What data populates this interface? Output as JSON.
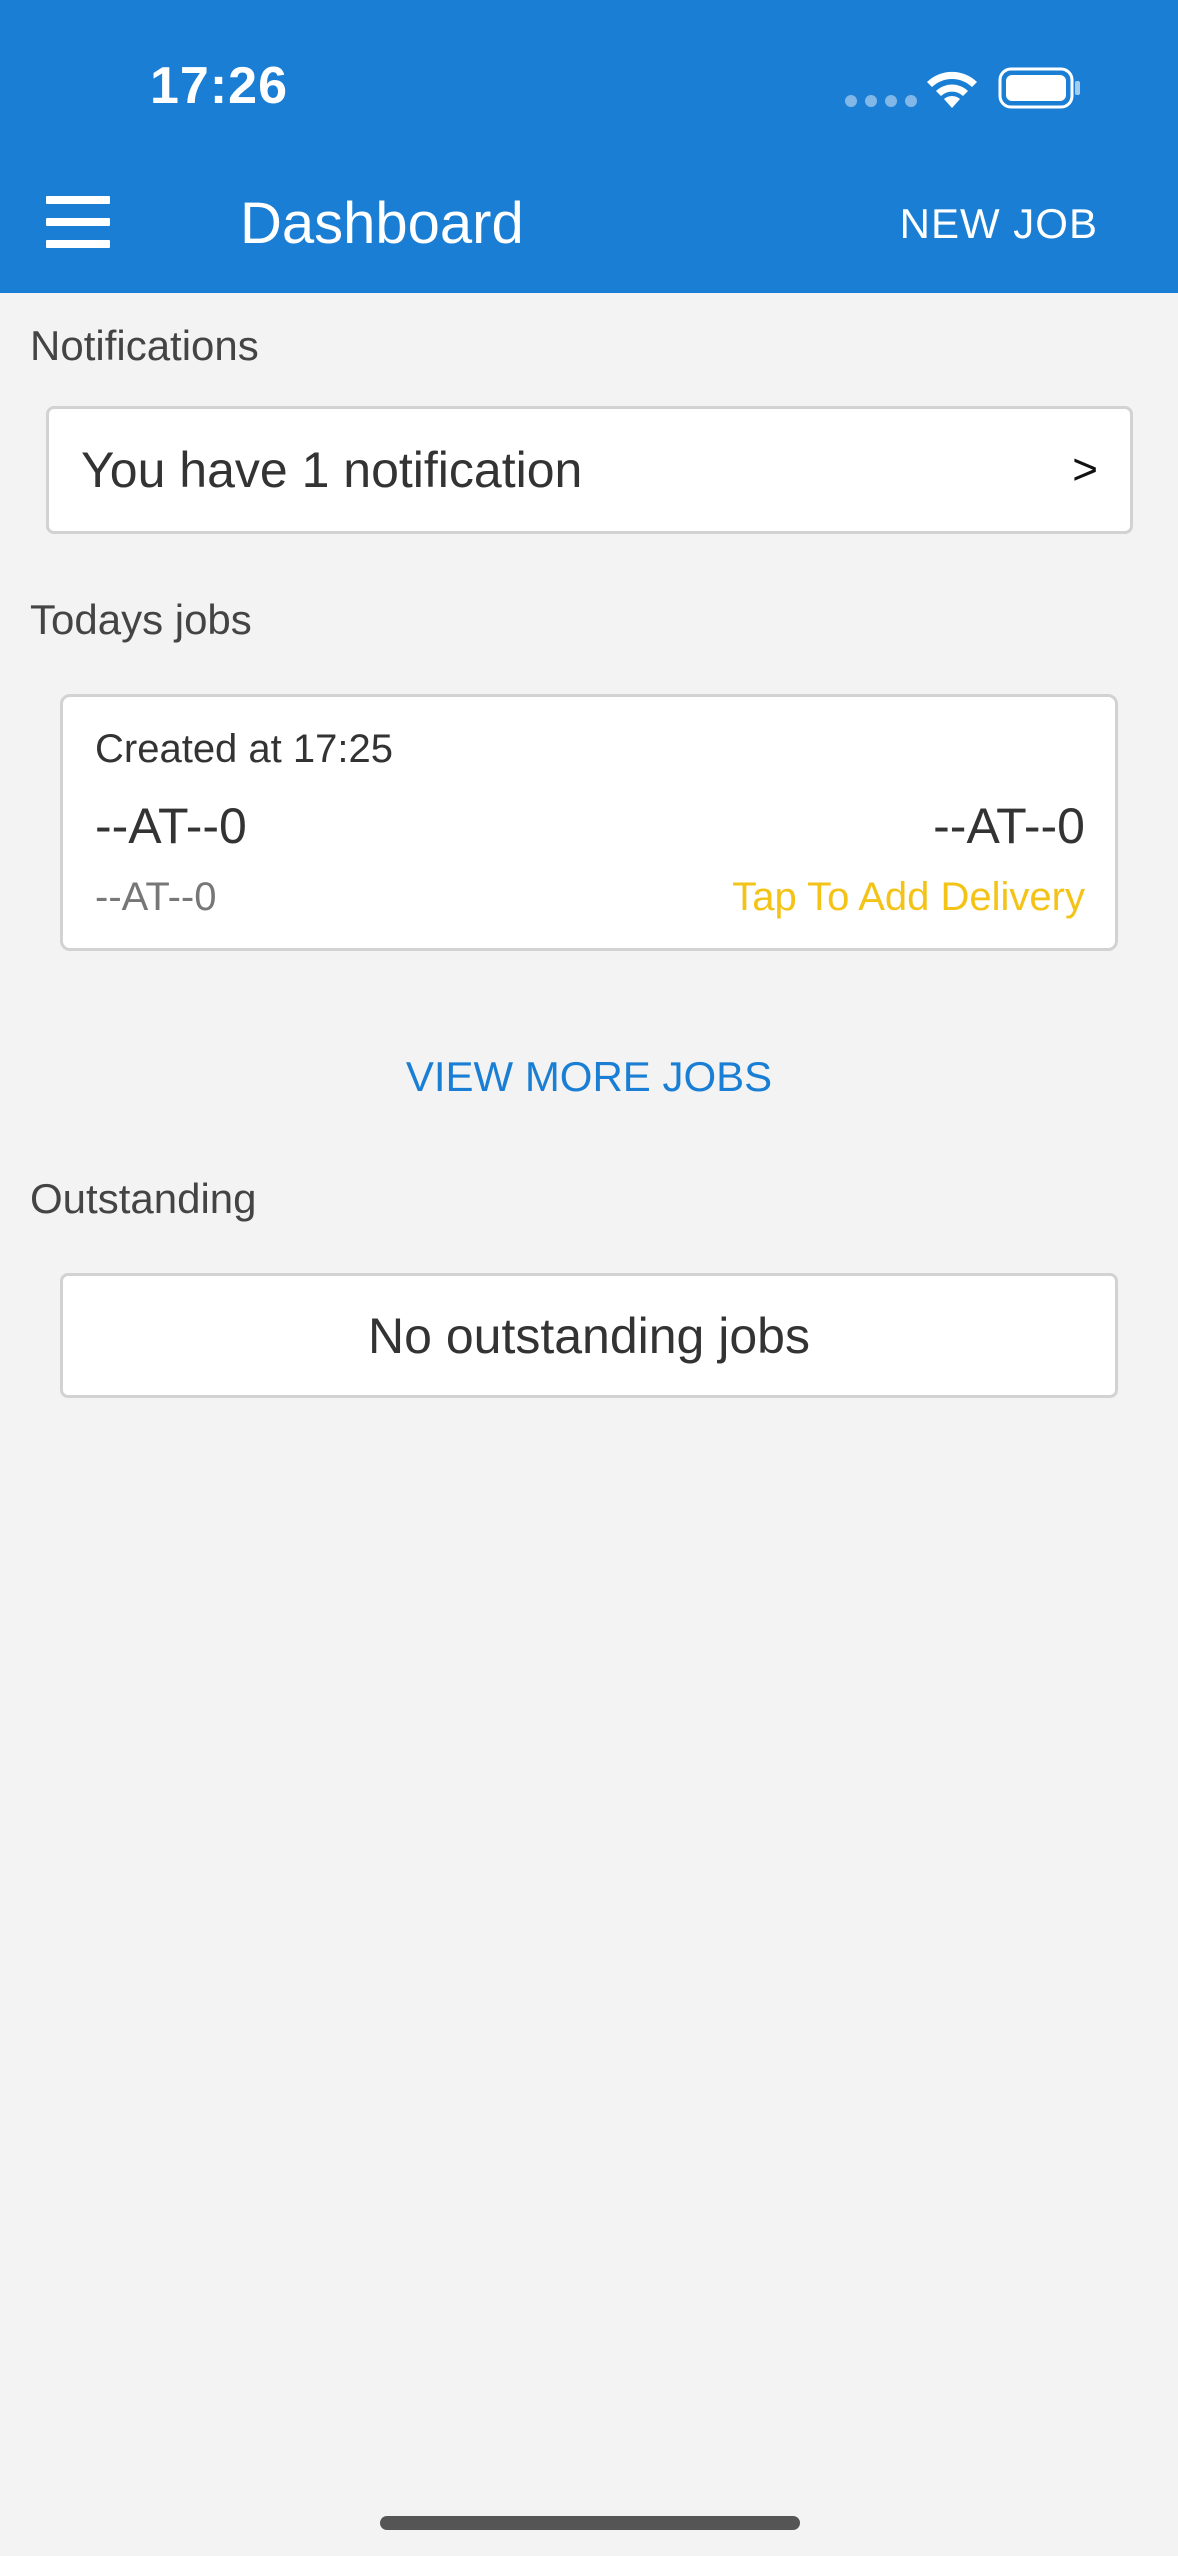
{
  "status_bar": {
    "time": "17:26",
    "icons": [
      "signal-dots-icon",
      "wifi-icon",
      "battery-icon"
    ]
  },
  "toolbar": {
    "menu_icon": "hamburger-menu-icon",
    "title": "Dashboard",
    "new_job_label": "NEW JOB"
  },
  "notifications": {
    "label": "Notifications",
    "message": "You have 1 notification",
    "chevron": ">"
  },
  "todays_jobs": {
    "label": "Todays jobs",
    "jobs": [
      {
        "created": "Created at 17:25",
        "left_code": "--AT--0",
        "right_code": "--AT--0",
        "sub_code": "--AT--0",
        "action": "Tap To Add Delivery"
      }
    ],
    "view_more_label": "VIEW MORE JOBS"
  },
  "outstanding": {
    "label": "Outstanding",
    "empty_text": "No outstanding jobs"
  },
  "colors": {
    "primary": "#1a7fd4",
    "accent": "#f3c318",
    "background": "#f3f3f3"
  }
}
